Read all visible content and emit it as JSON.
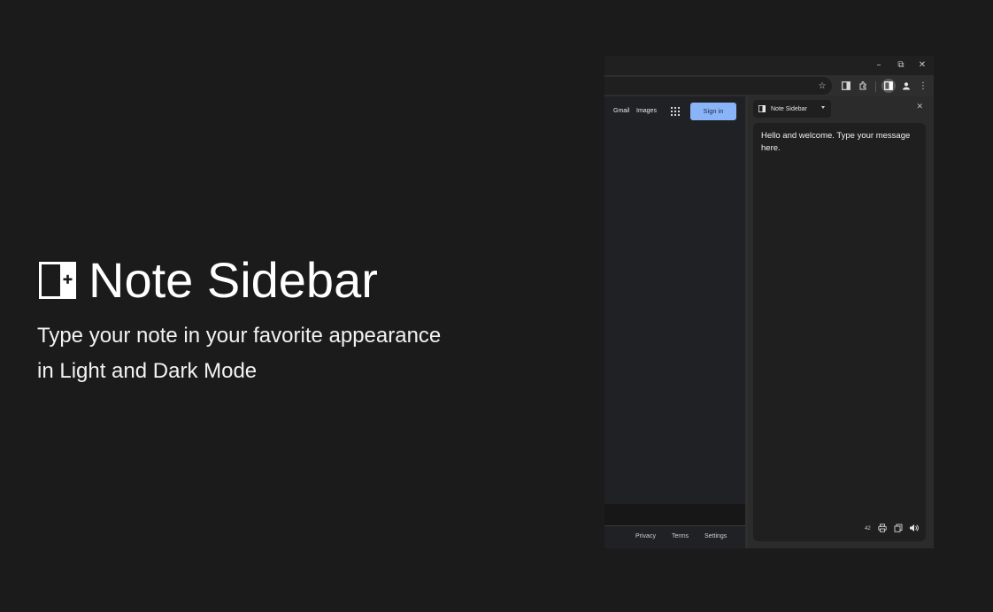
{
  "hero": {
    "title": "Note Sidebar",
    "subtitle_line1": "Type your note in your favorite appearance",
    "subtitle_line2": "in Light and Dark Mode"
  },
  "browser": {
    "window_controls": {
      "minimize": "–",
      "restore": "⧉",
      "close": "✕"
    },
    "toolbar_icons": [
      "star-icon",
      "side-panel-icon",
      "extensions-icon",
      "side-panel-active-icon",
      "profile-icon",
      "more-icon"
    ],
    "content": {
      "header_links": [
        "Gmail",
        "Images"
      ],
      "signin_label": "Sign in",
      "footer_links": [
        "Privacy",
        "Terms",
        "Settings"
      ]
    },
    "side_panel": {
      "selector_label": "Note Sidebar",
      "close_glyph": "✕",
      "note_text": "Hello and welcome. Type your message here.",
      "char_count": "42",
      "card_icons": [
        "print-icon",
        "copy-icon",
        "speaker-icon"
      ]
    }
  },
  "colors": {
    "background": "#1b1b1b",
    "signin_button": "#8ab4f8",
    "panel": "#2b2b2b",
    "note_card": "#1f1f1f"
  }
}
